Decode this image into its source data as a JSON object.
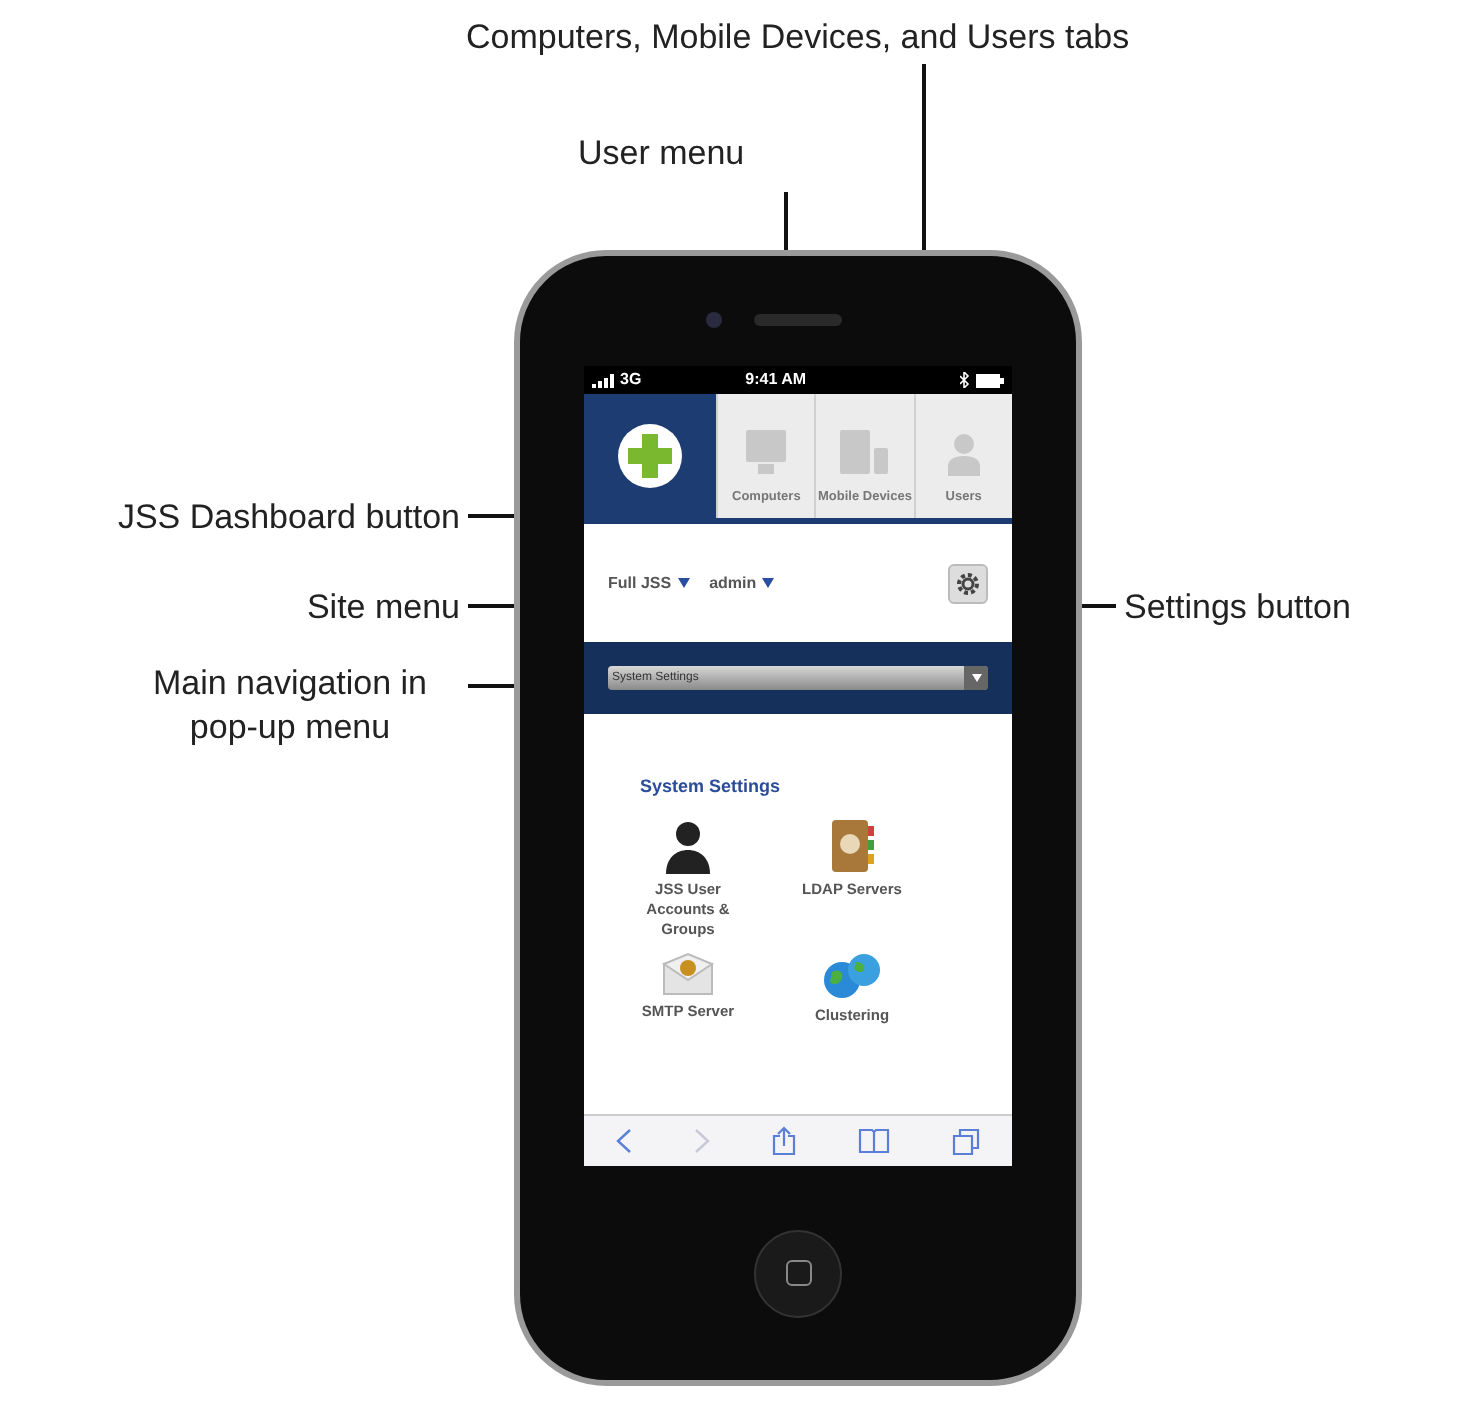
{
  "callouts": {
    "tabs": "Computers, Mobile Devices, and Users tabs",
    "user_menu": "User menu",
    "dashboard": "JSS Dashboard button",
    "site_menu": "Site menu",
    "main_nav": "Main navigation in pop-up menu",
    "settings": "Settings button"
  },
  "phone": {
    "status_bar": {
      "network": "3G",
      "time": "9:41 AM"
    },
    "tabs": [
      {
        "label": "Computers",
        "kind": "computer",
        "selected": false
      },
      {
        "label": "Mobile Devices",
        "kind": "mobile",
        "selected": false
      },
      {
        "label": "Users",
        "kind": "user",
        "selected": false
      }
    ],
    "site_menu": "Full JSS",
    "user_menu": "admin",
    "nav_select": {
      "value": "System Settings"
    },
    "section": {
      "title": "System Settings",
      "items": [
        {
          "label": "JSS User Accounts & Groups",
          "kind": "user"
        },
        {
          "label": "LDAP Servers",
          "kind": "ldap"
        },
        {
          "label": "SMTP Server",
          "kind": "smtp"
        },
        {
          "label": "Clustering",
          "kind": "cluster"
        }
      ]
    },
    "toolbar": {
      "back_disabled": false,
      "forward_disabled": true
    }
  }
}
